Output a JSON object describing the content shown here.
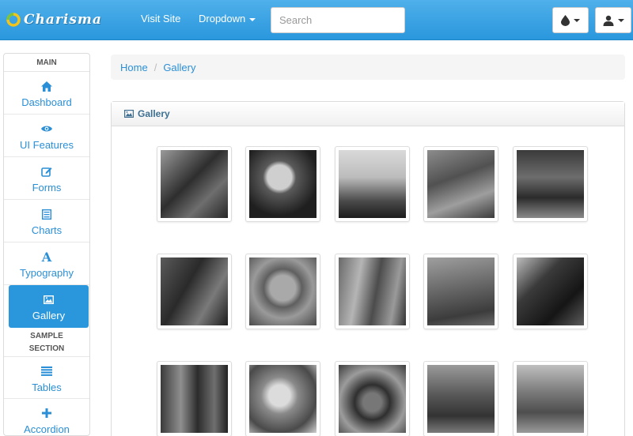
{
  "brand": {
    "name": "Charisma"
  },
  "navbar": {
    "links": [
      {
        "label": "Visit Site"
      },
      {
        "label": "Dropdown"
      }
    ],
    "search": {
      "placeholder": "Search"
    }
  },
  "icons": {
    "theme": "tint-icon",
    "user": "user-icon",
    "dashboard": "home-icon",
    "ui_features": "eye-icon",
    "forms": "edit-icon",
    "charts": "list-icon",
    "typography": "font-icon",
    "gallery": "picture-icon",
    "tables": "align-justify-icon",
    "accordion": "plus-icon"
  },
  "colors": {
    "accent": "#2a97dd",
    "link": "#2a8fd6",
    "navbar": "#3aa3e3"
  },
  "sidebar": {
    "section_main": "MAIN",
    "section_sample": "SAMPLE SECTION",
    "items": [
      {
        "label": "Dashboard"
      },
      {
        "label": "UI Features"
      },
      {
        "label": "Forms"
      },
      {
        "label": "Charts"
      },
      {
        "label": "Typography"
      },
      {
        "label": "Gallery"
      },
      {
        "label": "Tables"
      },
      {
        "label": "Accordion"
      }
    ],
    "active_item": "Gallery"
  },
  "breadcrumb": {
    "items": [
      "Home",
      "Gallery"
    ]
  },
  "panel": {
    "title": "Gallery"
  },
  "gallery": {
    "thumbnail_count": 15
  }
}
